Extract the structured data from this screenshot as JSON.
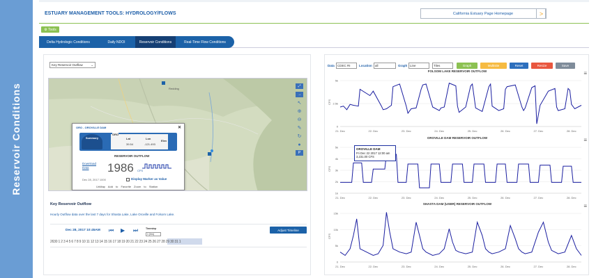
{
  "sidebar": {
    "label": "Reservoir Conditions"
  },
  "header": {
    "title": "ESTUARY MANAGEMENT TOOLS: HYDROLOGY/FLOWS",
    "home_button": "California Estuary Page Homepage",
    "home_arrow": ">"
  },
  "tools_label": "Tools",
  "tabs": [
    {
      "label": "Delta Hydrologic Conditions"
    },
    {
      "label": "Daily NDOI"
    },
    {
      "label": "Reservoir Conditions"
    },
    {
      "label": "Real-Time Flow Conditions"
    }
  ],
  "left_panel": {
    "dropdown": "Key Reservoir Outflow",
    "popup": {
      "title": "ORO - OROVILLE DAM",
      "summary": "Summary",
      "station": "ORO",
      "lat_label": "Lat",
      "lon_label": "Lon",
      "elev_label": "Elev",
      "lat": "39.54",
      "lon": "-121.493",
      "download": "Download Data",
      "reservoir_outflow": "RESERVOIR OUTFLOW",
      "value": "1986",
      "unit": "CFS",
      "date": "Dec 28, 2017 1000",
      "display_marker": "Display Marker as Value",
      "links": [
        "UnMap",
        "Add to Favorite",
        "Zoom to Station"
      ]
    },
    "section_title": "Key Reservoir Outflow",
    "section_desc": "Hourly Outflow data over the last 7 days for Shasta Lake, Lake Oroville and Folsom Lake.",
    "timeline": {
      "date": "Dec 28, 2017 10:45AM",
      "timestep_label": "Timestep",
      "timestep_value": "1 (hrs)",
      "adjust_button": "Adjust Timeline",
      "ticks": "2630 1  2  3  4  5  6  7  8  9  10 11 12 13 14 15 16 17 18 19 20 21 22 23 24 25 26 27 28 29 30 31 1"
    }
  },
  "right_panel": {
    "controls": {
      "data_label": "Data",
      "data_value": "CDEC RI",
      "location_label": "Location",
      "location_value": "all",
      "graph_label": "Graph",
      "graph_value": "Line",
      "tiles_value": "Tiles",
      "buttons": [
        {
          "label": "Graph",
          "color": "#8cc152"
        },
        {
          "label": "Multisite",
          "color": "#f6bb42"
        },
        {
          "label": "Reset",
          "color": "#2d6fbd"
        },
        {
          "label": "Resize",
          "color": "#e9573f"
        },
        {
          "label": "Save",
          "color": "#7f8c9a"
        }
      ]
    },
    "tooltip": {
      "title": "OROVILLE DAM",
      "date": "Fri Dec 22 2017 12:00 am",
      "value": "3,231.00 CFS"
    }
  },
  "chart_data": [
    {
      "type": "line",
      "title": "FOLSOM LAKE RESERVOIR OUTFLOW",
      "ylabel": "CFS",
      "x_ticks": [
        "21. Dec",
        "22. Dec",
        "23. Dec",
        "24. Dec",
        "25. Dec",
        "26. Dec",
        "27. Dec",
        "28. Dec"
      ],
      "y_ticks": [
        "0",
        "2.5k",
        "5k"
      ],
      "ylim": [
        0,
        5500
      ],
      "x": [
        0,
        0.1,
        0.2,
        0.3,
        0.4,
        0.55,
        0.6,
        0.9,
        1.0,
        1.25,
        1.3,
        1.4,
        1.55,
        1.6,
        1.8,
        2.0,
        2.05,
        2.15,
        2.3,
        2.45,
        2.5,
        2.6,
        2.8,
        3.0,
        3.05,
        3.15,
        3.3,
        3.5,
        3.55,
        3.6,
        3.8,
        3.95,
        4.0,
        4.1,
        4.3,
        4.5,
        4.55,
        4.6,
        4.8,
        4.95,
        5.0,
        5.05,
        5.3,
        5.5,
        5.55,
        5.6,
        5.8,
        5.9,
        5.95,
        6.05,
        6.3,
        6.5,
        6.55,
        6.6,
        6.8,
        6.9,
        6.95,
        7.0,
        7.1,
        7.3
      ],
      "series": [
        {
          "values": [
            2200,
            2300,
            1900,
            2500,
            2400,
            2300,
            4200,
            3500,
            4000,
            2300,
            1900,
            2000,
            2400,
            4500,
            4800,
            2300,
            1500,
            2000,
            2100,
            4200,
            4700,
            4800,
            2200,
            1800,
            2100,
            2200,
            4900,
            4600,
            2300,
            1600,
            2200,
            4600,
            4800,
            2100,
            1700,
            4500,
            4800,
            2300,
            1800,
            2000,
            4200,
            4500,
            4700,
            2200,
            1800,
            2100,
            4400,
            4600,
            300,
            2400,
            4000,
            4300,
            2200,
            1800,
            2000,
            4300,
            4100,
            2500,
            2000,
            2400
          ]
        }
      ]
    },
    {
      "type": "line",
      "title": "OROVILLE DAM RESERVOIR OUTFLOW",
      "ylabel": "CFS",
      "x_ticks": [
        "21. Dec",
        "22. Dec",
        "23. Dec",
        "24. Dec",
        "25. Dec",
        "26. Dec",
        "27. Dec",
        "28. Dec"
      ],
      "y_ticks": [
        "1k",
        "2k",
        "3k",
        "4k",
        "5k"
      ],
      "ylim": [
        1000,
        5500
      ],
      "x": [
        0,
        0.35,
        0.4,
        0.65,
        0.7,
        0.95,
        1.0,
        1.35,
        1.4,
        1.7,
        1.75,
        2.0,
        2.05,
        2.35,
        2.4,
        2.7,
        2.75,
        3.0,
        3.05,
        3.35,
        3.4,
        3.7,
        3.75,
        4.0,
        4.05,
        4.35,
        4.4,
        4.7,
        4.75,
        5.0,
        5.05,
        5.35,
        5.4,
        5.7,
        5.75,
        6.0,
        6.05,
        6.35,
        6.4,
        6.7,
        6.75,
        7.0,
        7.05,
        7.3
      ],
      "series": [
        {
          "values": [
            2000,
            2000,
            3800,
            3800,
            2000,
            2000,
            3231,
            3231,
            4600,
            4600,
            2000,
            2000,
            3700,
            3700,
            1500,
            1500,
            3700,
            3700,
            2000,
            2000,
            3700,
            3700,
            2000,
            2000,
            3700,
            3700,
            2000,
            2000,
            3700,
            3700,
            2000,
            2000,
            3700,
            3700,
            2000,
            2000,
            3600,
            3600,
            2000,
            2000,
            3500,
            3500,
            2000,
            2000
          ]
        }
      ]
    },
    {
      "type": "line",
      "title": "SHASTA DAM (USBR) RESERVOIR OUTFLOW",
      "ylabel": "CFS",
      "x_ticks": [
        "21. Dec",
        "22. Dec",
        "23. Dec",
        "24. Dec",
        "25. Dec",
        "26. Dec",
        "27. Dec",
        "28. Dec"
      ],
      "y_ticks": [
        "0",
        "5k",
        "10k",
        "15k"
      ],
      "ylim": [
        0,
        15500
      ],
      "x": [
        0,
        0.15,
        0.3,
        0.4,
        0.5,
        0.6,
        0.8,
        1.0,
        1.15,
        1.3,
        1.4,
        1.5,
        1.6,
        1.8,
        2.0,
        2.15,
        2.3,
        2.4,
        2.5,
        2.6,
        2.8,
        3.0,
        3.15,
        3.3,
        3.4,
        3.5,
        3.6,
        3.8,
        4.0,
        4.15,
        4.3,
        4.4,
        4.5,
        4.6,
        4.8,
        5.0,
        5.15,
        5.3,
        5.4,
        5.5,
        5.6,
        5.8,
        6.0,
        6.15,
        6.3,
        6.4,
        6.5,
        6.6,
        6.8,
        7.0,
        7.15,
        7.3
      ],
      "series": [
        {
          "values": [
            3000,
            2000,
            4000,
            8000,
            13000,
            4000,
            3000,
            2000,
            2500,
            5000,
            15000,
            9000,
            4000,
            3000,
            2500,
            3000,
            12000,
            8000,
            4000,
            3000,
            2000,
            2500,
            4000,
            10000,
            6000,
            3500,
            3000,
            2500,
            3000,
            12000,
            8000,
            4000,
            3000,
            2500,
            3000,
            4000,
            11000,
            7000,
            4000,
            3000,
            2500,
            3000,
            9000,
            12000,
            6000,
            3500,
            3000,
            2500,
            3000,
            8000,
            4000,
            2000
          ]
        }
      ]
    }
  ]
}
